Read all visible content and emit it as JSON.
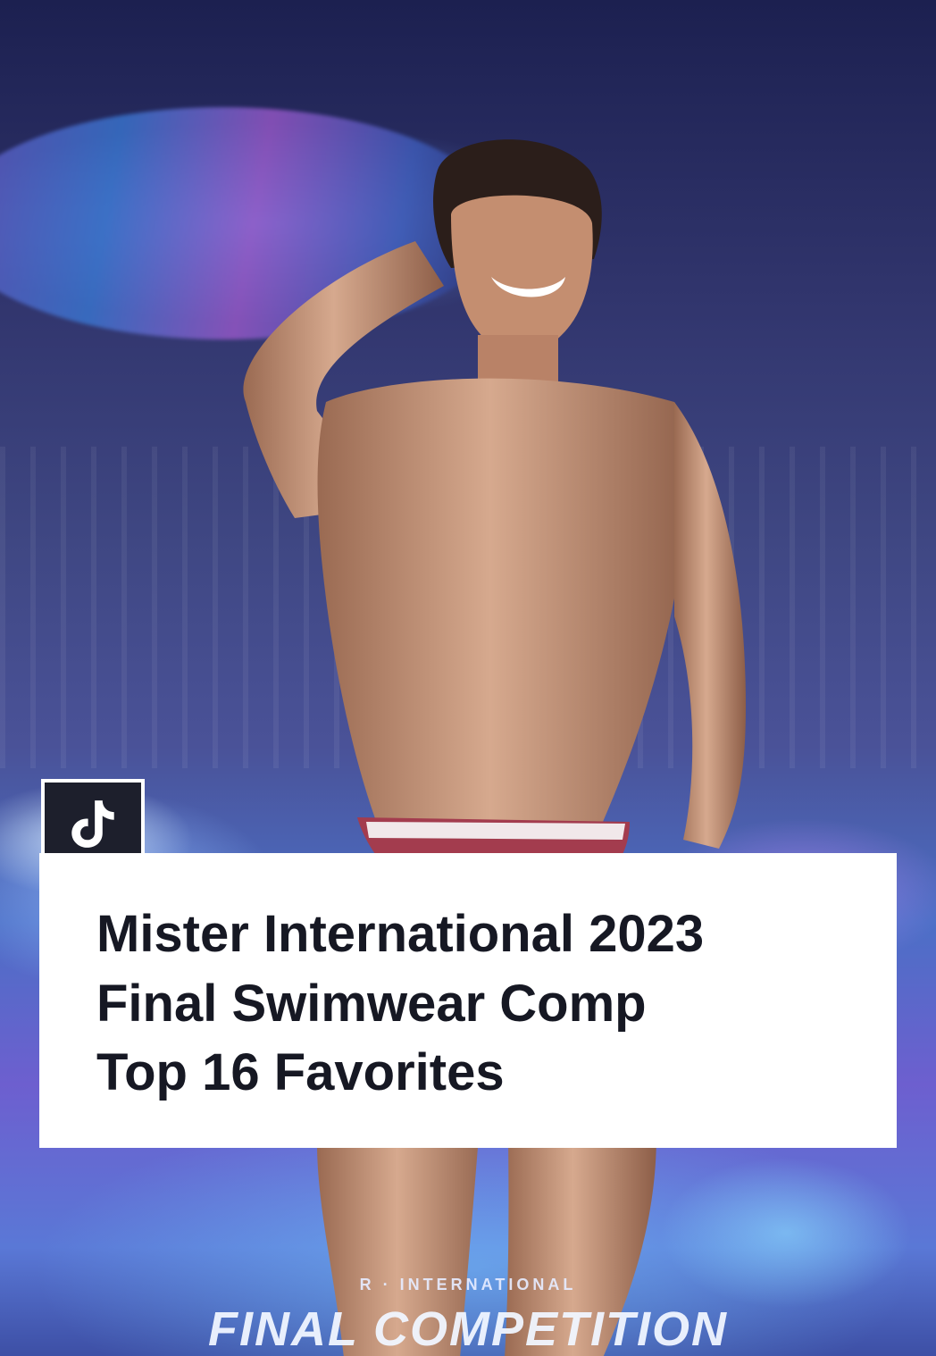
{
  "video": {
    "stage_logo_small": "R · INTERNATIONAL",
    "stage_logo_large": "FINAL COMPETITION"
  },
  "badge": {
    "icon": "tiktok-logo-icon",
    "bg_color": "#1d1f2c"
  },
  "caption": {
    "lines": [
      "Mister International 2023",
      "Final Swimwear Comp",
      "Top 16 Favorites"
    ],
    "text_color": "#161823",
    "box_color": "#ffffff"
  }
}
